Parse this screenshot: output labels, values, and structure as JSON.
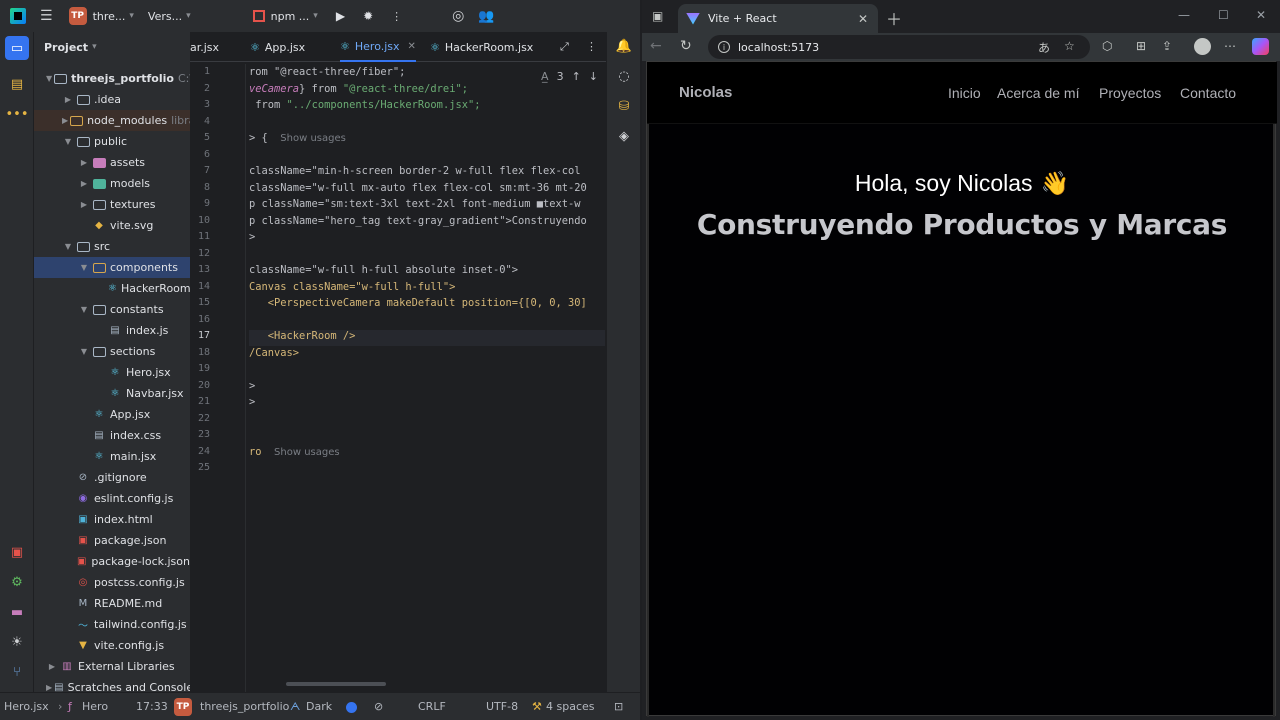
{
  "ide": {
    "top_bar": {
      "project_badge": "TP",
      "project_name": "thre...",
      "vcs_label": "Vers...",
      "run_config": "npm ...",
      "run_badge": "npm"
    },
    "project_panel": {
      "title": "Project",
      "items": [
        {
          "label": "threejs_portfolio",
          "suffix": "C:\\U"
        },
        {
          "label": ".idea"
        },
        {
          "label": "node_modules",
          "suffix": "libra"
        },
        {
          "label": "public"
        },
        {
          "label": "assets"
        },
        {
          "label": "models"
        },
        {
          "label": "textures"
        },
        {
          "label": "vite.svg"
        },
        {
          "label": "src"
        },
        {
          "label": "components"
        },
        {
          "label": "HackerRoom."
        },
        {
          "label": "constants"
        },
        {
          "label": "index.js"
        },
        {
          "label": "sections"
        },
        {
          "label": "Hero.jsx"
        },
        {
          "label": "Navbar.jsx"
        },
        {
          "label": "App.jsx"
        },
        {
          "label": "index.css"
        },
        {
          "label": "main.jsx"
        },
        {
          "label": ".gitignore"
        },
        {
          "label": "eslint.config.js"
        },
        {
          "label": "index.html"
        },
        {
          "label": "package.json"
        },
        {
          "label": "package-lock.json"
        },
        {
          "label": "postcss.config.js"
        },
        {
          "label": "README.md"
        },
        {
          "label": "tailwind.config.js"
        },
        {
          "label": "vite.config.js"
        },
        {
          "label": "External Libraries"
        },
        {
          "label": "Scratches and Console"
        }
      ]
    },
    "tabs": [
      {
        "label": "ar.jsx"
      },
      {
        "label": "App.jsx"
      },
      {
        "label": "Hero.jsx"
      },
      {
        "label": "HackerRoom.jsx"
      }
    ],
    "inspection": {
      "count": "3"
    },
    "line_numbers": [
      "1",
      "2",
      "3",
      "4",
      "5",
      "6",
      "7",
      "8",
      "9",
      "10",
      "11",
      "12",
      "13",
      "14",
      "15",
      "16",
      "17",
      "18",
      "19",
      "20",
      "21",
      "22",
      "23",
      "24",
      "25"
    ],
    "current_line": "17",
    "code": {
      "l1": "rom \"@react-three/fiber\";",
      "l2a": "veCamera",
      "l2b": "} from ",
      "l2c": "\"@react-three/drei\";",
      "l3a": " from ",
      "l3b": "\"../components/HackerRoom.jsx\";",
      "l5a": "> {  ",
      "l5b": "Show usages",
      "l7": "className=\"min-h-screen border-2 w-full flex flex-col",
      "l8": "className=\"w-full mx-auto flex flex-col sm:mt-36 mt-20",
      "l9": "p className=\"sm:text-3xl text-2xl font-medium ■text-w",
      "l10": "p className=\"hero_tag text-gray_gradient\">Construyendo",
      "l11": ">",
      "l13": "className=\"w-full h-full absolute inset-0\">",
      "l14": "Canvas className=\"w-full h-full\">",
      "l15": "   <PerspectiveCamera makeDefault position={[0, 0, 30]",
      "l17": "   <HackerRoom />",
      "l18": "/Canvas>",
      "l20": ">",
      "l21": ">",
      "l24a": "ro  ",
      "l24b": "Show usages"
    },
    "status_bar": {
      "file": "Hero.jsx",
      "symbol": "Hero",
      "position": "17:33",
      "project_badge": "TP",
      "project": "threejs_portfolio",
      "theme": "Dark",
      "line_sep": "CRLF",
      "encoding": "UTF-8",
      "indent": "4 spaces"
    }
  },
  "browser": {
    "tab_title": "Vite + React",
    "url": "localhost:5173",
    "site": {
      "logo": "Nicolas",
      "nav": [
        "Inicio",
        "Acerca de mí",
        "Proyectos",
        "Contacto"
      ],
      "greeting": "Hola, soy Nicolas",
      "wave": "👋",
      "tagline": "Construyendo Productos y Marcas"
    }
  },
  "colors": {
    "accent": "#3574f0",
    "ide_bg": "#1e1f22",
    "panel_bg": "#2b2d30",
    "site_bg": "#010103",
    "site_text": "#afb0b6"
  }
}
